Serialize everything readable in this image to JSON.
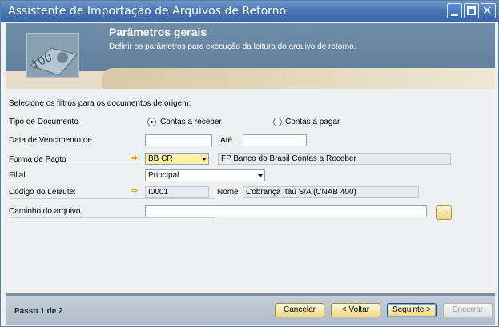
{
  "window": {
    "title": "Assistente de Importação de Arquivos de Retorno"
  },
  "header": {
    "title": "Parâmetros gerais",
    "subtitle": "Definir os parâmetros para execução da leitura do arquivo de retorno."
  },
  "form": {
    "intro": "Selecione os filtros para os documentos de origem:",
    "tipo_documento_label": "Tipo de Documento",
    "option_receber": "Contas a receber",
    "option_pagar": "Contas a pagar",
    "selected_option": "Contas a receber",
    "data_vencimento_label": "Data de Vencimento de",
    "data_vencimento_de": "",
    "ate_label": "Até",
    "data_vencimento_ate": "",
    "forma_pagto_label": "Forma de Pagto",
    "forma_pagto_value": "BB CR",
    "forma_pagto_desc": "FP Banco do Brasil Contas a Receber",
    "filial_label": "Filial",
    "filial_value": "Principal",
    "codigo_leiaute_label": "Código do Leiaute:",
    "codigo_leiaute_value": "I0001",
    "nome_label": "Nome",
    "nome_value": "Cobrança Itaú S/A (CNAB 400)",
    "caminho_label": "Caminho do arquivo",
    "caminho_value": "",
    "browse_label": "..."
  },
  "footer": {
    "step": "Passo 1 de 2",
    "cancel": "Cancelar",
    "back": "< Voltar",
    "next": "Seguinte >",
    "finish": "Encerrar"
  },
  "colors": {
    "titlebar": "#4a76b3",
    "header": "#6f8ea9",
    "accent_yellow": "#f3d87a"
  }
}
